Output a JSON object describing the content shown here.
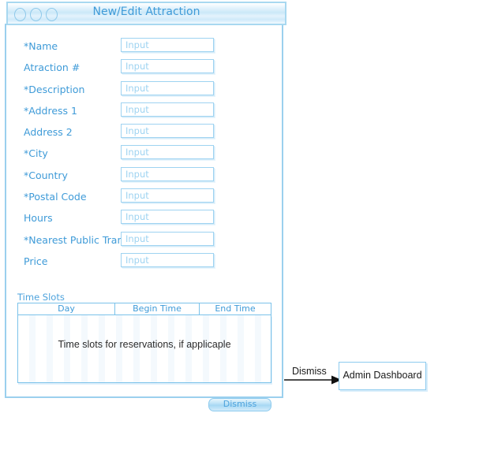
{
  "window": {
    "title": "New/Edit Attraction",
    "controls": [
      {
        "name": "window-control-close"
      },
      {
        "name": "window-control-minimize"
      },
      {
        "name": "window-control-zoom"
      }
    ]
  },
  "form": {
    "input_placeholder": "Input",
    "fields": [
      {
        "label": "*Name",
        "value": "Input"
      },
      {
        "label": "Atraction #",
        "value": "Input"
      },
      {
        "label": "*Description",
        "value": "Input"
      },
      {
        "label": "*Address 1",
        "value": "Input"
      },
      {
        "label": "Address 2",
        "value": "Input"
      },
      {
        "label": "*City",
        "value": "Input"
      },
      {
        "label": "*Country",
        "value": "Input"
      },
      {
        "label": "*Postal Code",
        "value": "Input"
      },
      {
        "label": "Hours",
        "value": "Input"
      },
      {
        "label": "*Nearest Public Transport",
        "value": "Input"
      },
      {
        "label": "Price",
        "value": "Input"
      }
    ]
  },
  "timeslots": {
    "section_label": "Time Slots",
    "columns": [
      "Day",
      "Begin Time",
      "End Time"
    ],
    "empty_note": "Time slots for reservations, if applicaple"
  },
  "actions": {
    "dismiss_label": "Dismiss"
  },
  "flow": {
    "transition_label": "Dismiss",
    "target_screen": "Admin Dashboard"
  },
  "colors": {
    "wireframe_blue": "#4ea3dd",
    "border_blue": "#9bd0ee",
    "text_dark": "#1a1a1a"
  }
}
